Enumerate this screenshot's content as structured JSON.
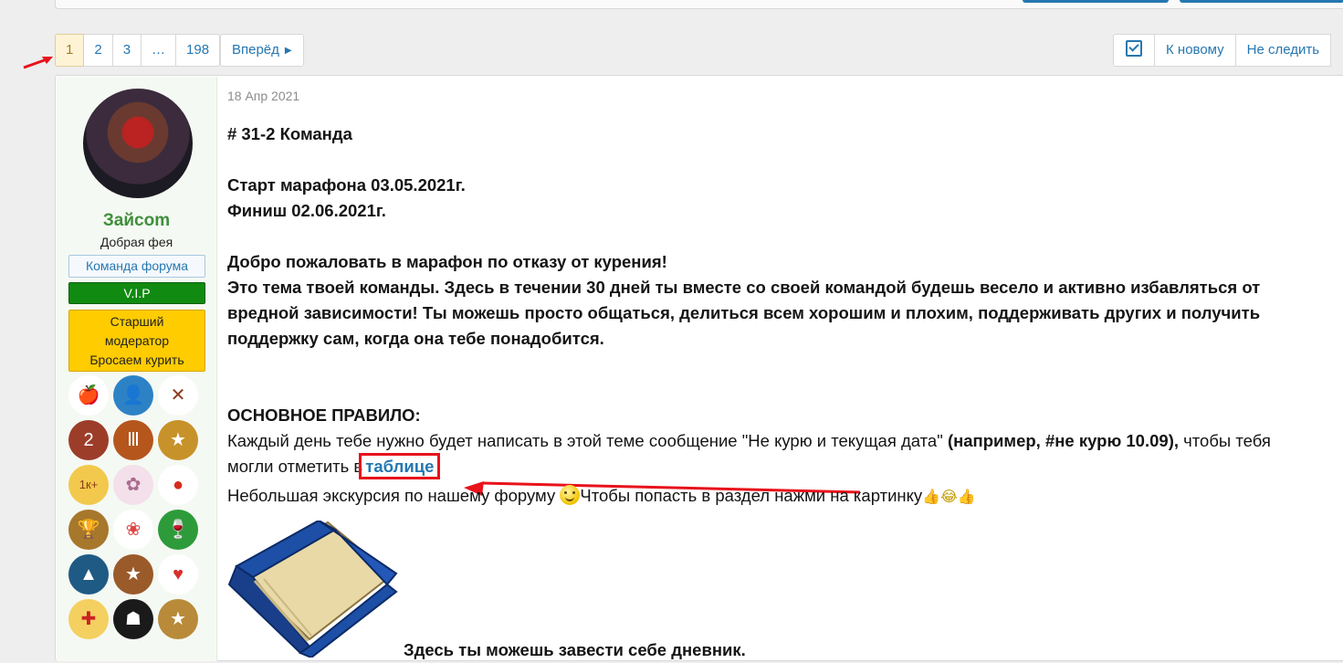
{
  "pagination": {
    "pages": [
      "1",
      "2",
      "3",
      "…",
      "198"
    ],
    "current": "1",
    "next_label": "Вперёд"
  },
  "thread_actions": {
    "new_label": "К новому",
    "unwatch_label": "Не следить"
  },
  "post": {
    "date": "18 Апр 2021",
    "author": {
      "name": "Зайсom",
      "title": "Добрая фея",
      "banners": {
        "team": "Команда форума",
        "vip": "V.I.P",
        "mod_line1": "Старший",
        "mod_line2": "модератор",
        "mod_line3": "Бросаем курить"
      },
      "colors": {
        "name": "#3f8f3b",
        "vip": "#108a10",
        "mod": "#ffcc00"
      }
    },
    "content": {
      "heading": "# 31-2 Команда",
      "start": "Старт марафона 03.05.2021г.",
      "finish": "Финиш 02.06.2021г.",
      "welcome": "Добро пожаловать в марафон по отказу от курения!",
      "para1": "Это тема твоей команды. Здесь в течении 30 дней ты вместе со своей командой будешь весело и активно избавляться от",
      "para2": "вредной зависимости! Ты можешь просто общаться, делиться всем хорошим и плохим, поддерживать других и получить",
      "para3": "поддержку сам, когда она тебе понадобится.",
      "rule_title": "ОСНОВНОЕ ПРАВИЛО:",
      "rule_text": "Каждый день тебе нужно будет написать в этой теме сообщение \"Не курю и текущая дата\"",
      "rule_example": "(например, #не курю 10.09),",
      "rule_tail": "чтобы тебя",
      "rule_line2": "могли отметить в",
      "table_link": "таблице",
      "tour_text_1": "Небольшая экскурсия по нашему форуму",
      "tour_text_2": "Чтобы попасть в раздел нажми на картинку",
      "diary": "Здесь ты можешь завести себе дневник."
    }
  },
  "accent_color": "#2577b1",
  "annotation_color": "#e8121b"
}
